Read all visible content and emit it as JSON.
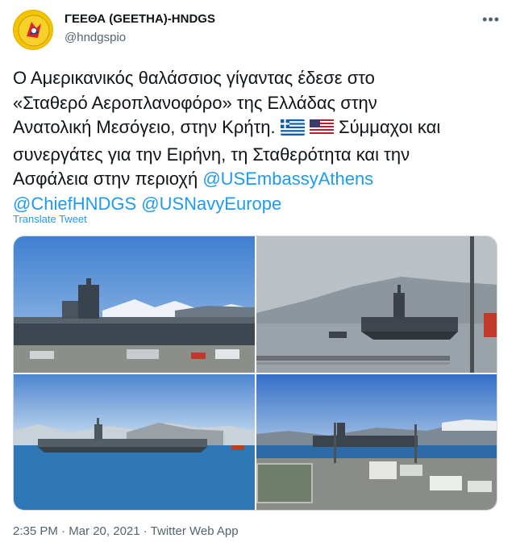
{
  "author": {
    "name": "ΓΕΕΘΑ (GEETHA)-HNDGS",
    "handle": "@hndgspio",
    "more_icon": "more-icon"
  },
  "tweet": {
    "text_line1": "Ο Αμερικανικός θαλάσσιος γίγαντας έδεσε στο",
    "text_line2": "«Σταθερό Αεροπλανοφόρο» της Ελλάδας στην",
    "text_line3a": "Ανατολική Μεσόγειο, στην Κρήτη.",
    "text_line3b": "Σύμμαχοι και",
    "text_line4": "συνεργάτες για την Ειρήνη, τη Σταθερότητα και την",
    "text_line5": "Ασφάλεια στην περιοχή",
    "mention1": "@USEmbassyAthens",
    "mention2": "@ChiefHNDGS",
    "mention3": "@USNavyEurope",
    "flag_icons": [
      "greece-flag-icon",
      "usa-flag-icon"
    ]
  },
  "translate_label": "Translate Tweet",
  "meta": {
    "time": "2:35 PM",
    "sep1": " · ",
    "date": "Mar 20, 2021",
    "sep2": " · ",
    "source": "Twitter Web App"
  },
  "colors": {
    "link": "#1d9bf0",
    "secondary": "#536471",
    "text": "#0f1419"
  }
}
